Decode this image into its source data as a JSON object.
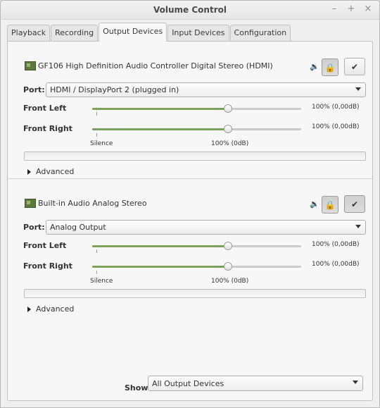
{
  "window": {
    "title": "Volume Control",
    "controls": [
      "–",
      "+",
      "×"
    ]
  },
  "tabs": [
    {
      "label": "Playback",
      "active": false
    },
    {
      "label": "Recording",
      "active": false
    },
    {
      "label": "Output Devices",
      "active": true
    },
    {
      "label": "Input Devices",
      "active": false
    },
    {
      "label": "Configuration",
      "active": false
    }
  ],
  "devices": [
    {
      "name": "GF106 High Definition Audio Controller Digital Stereo (HDMI)",
      "port_label": "Port:",
      "port_value": "HDMI / DisplayPort 2 (plugged in)",
      "channels": [
        {
          "label": "Front Left",
          "value": "100% (0,00dB)",
          "level": 0.65
        },
        {
          "label": "Front Right",
          "value": "100% (0,00dB)",
          "level": 0.65
        }
      ],
      "scale": {
        "silence": "Silence",
        "normal": "100% (0dB)"
      },
      "advanced": "Advanced",
      "speaker_icon": "speaker-icon",
      "lock_icon": "lock-icon",
      "check_icon": "checkmark-icon"
    },
    {
      "name": "Built-in Audio Analog Stereo",
      "port_label": "Port:",
      "port_value": "Analog Output",
      "channels": [
        {
          "label": "Front Left",
          "value": "100% (0,00dB)",
          "level": 0.65
        },
        {
          "label": "Front Right",
          "value": "100% (0,00dB)",
          "level": 0.65
        }
      ],
      "scale": {
        "silence": "Silence",
        "normal": "100% (0dB)"
      },
      "advanced": "Advanced",
      "speaker_icon": "speaker-icon",
      "lock_icon": "lock-icon",
      "check_icon": "checkmark-icon"
    }
  ],
  "footer": {
    "show_label": "Show:",
    "show_value": "All Output Devices"
  },
  "colors": {
    "slider_fill": "#7aa15b",
    "card_icon": "#5c7a3e"
  }
}
